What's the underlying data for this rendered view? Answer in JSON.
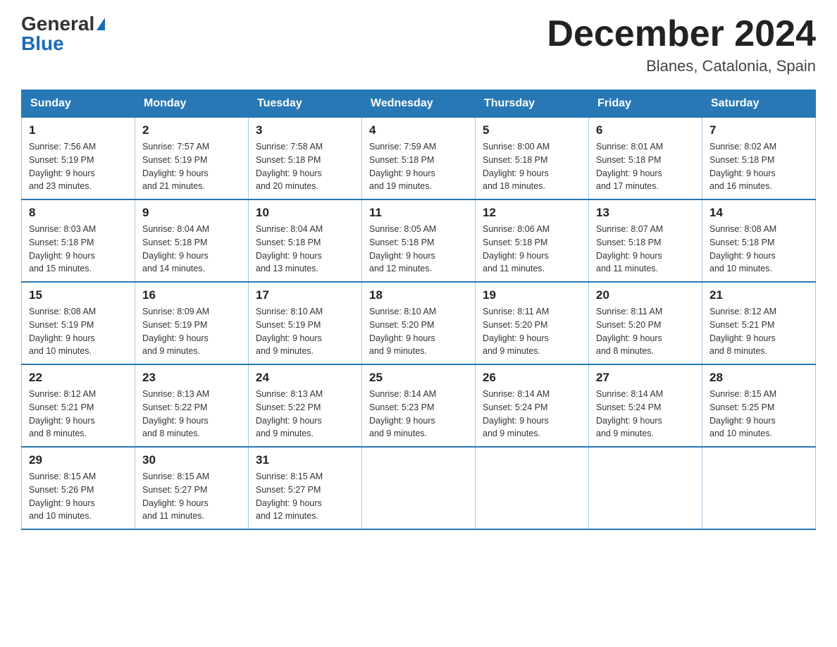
{
  "header": {
    "logo_general": "General",
    "logo_blue": "Blue",
    "month_title": "December 2024",
    "location": "Blanes, Catalonia, Spain"
  },
  "days_of_week": [
    "Sunday",
    "Monday",
    "Tuesday",
    "Wednesday",
    "Thursday",
    "Friday",
    "Saturday"
  ],
  "weeks": [
    [
      {
        "day": "1",
        "sunrise": "7:56 AM",
        "sunset": "5:19 PM",
        "daylight": "9 hours and 23 minutes."
      },
      {
        "day": "2",
        "sunrise": "7:57 AM",
        "sunset": "5:19 PM",
        "daylight": "9 hours and 21 minutes."
      },
      {
        "day": "3",
        "sunrise": "7:58 AM",
        "sunset": "5:18 PM",
        "daylight": "9 hours and 20 minutes."
      },
      {
        "day": "4",
        "sunrise": "7:59 AM",
        "sunset": "5:18 PM",
        "daylight": "9 hours and 19 minutes."
      },
      {
        "day": "5",
        "sunrise": "8:00 AM",
        "sunset": "5:18 PM",
        "daylight": "9 hours and 18 minutes."
      },
      {
        "day": "6",
        "sunrise": "8:01 AM",
        "sunset": "5:18 PM",
        "daylight": "9 hours and 17 minutes."
      },
      {
        "day": "7",
        "sunrise": "8:02 AM",
        "sunset": "5:18 PM",
        "daylight": "9 hours and 16 minutes."
      }
    ],
    [
      {
        "day": "8",
        "sunrise": "8:03 AM",
        "sunset": "5:18 PM",
        "daylight": "9 hours and 15 minutes."
      },
      {
        "day": "9",
        "sunrise": "8:04 AM",
        "sunset": "5:18 PM",
        "daylight": "9 hours and 14 minutes."
      },
      {
        "day": "10",
        "sunrise": "8:04 AM",
        "sunset": "5:18 PM",
        "daylight": "9 hours and 13 minutes."
      },
      {
        "day": "11",
        "sunrise": "8:05 AM",
        "sunset": "5:18 PM",
        "daylight": "9 hours and 12 minutes."
      },
      {
        "day": "12",
        "sunrise": "8:06 AM",
        "sunset": "5:18 PM",
        "daylight": "9 hours and 11 minutes."
      },
      {
        "day": "13",
        "sunrise": "8:07 AM",
        "sunset": "5:18 PM",
        "daylight": "9 hours and 11 minutes."
      },
      {
        "day": "14",
        "sunrise": "8:08 AM",
        "sunset": "5:18 PM",
        "daylight": "9 hours and 10 minutes."
      }
    ],
    [
      {
        "day": "15",
        "sunrise": "8:08 AM",
        "sunset": "5:19 PM",
        "daylight": "9 hours and 10 minutes."
      },
      {
        "day": "16",
        "sunrise": "8:09 AM",
        "sunset": "5:19 PM",
        "daylight": "9 hours and 9 minutes."
      },
      {
        "day": "17",
        "sunrise": "8:10 AM",
        "sunset": "5:19 PM",
        "daylight": "9 hours and 9 minutes."
      },
      {
        "day": "18",
        "sunrise": "8:10 AM",
        "sunset": "5:20 PM",
        "daylight": "9 hours and 9 minutes."
      },
      {
        "day": "19",
        "sunrise": "8:11 AM",
        "sunset": "5:20 PM",
        "daylight": "9 hours and 9 minutes."
      },
      {
        "day": "20",
        "sunrise": "8:11 AM",
        "sunset": "5:20 PM",
        "daylight": "9 hours and 8 minutes."
      },
      {
        "day": "21",
        "sunrise": "8:12 AM",
        "sunset": "5:21 PM",
        "daylight": "9 hours and 8 minutes."
      }
    ],
    [
      {
        "day": "22",
        "sunrise": "8:12 AM",
        "sunset": "5:21 PM",
        "daylight": "9 hours and 8 minutes."
      },
      {
        "day": "23",
        "sunrise": "8:13 AM",
        "sunset": "5:22 PM",
        "daylight": "9 hours and 8 minutes."
      },
      {
        "day": "24",
        "sunrise": "8:13 AM",
        "sunset": "5:22 PM",
        "daylight": "9 hours and 9 minutes."
      },
      {
        "day": "25",
        "sunrise": "8:14 AM",
        "sunset": "5:23 PM",
        "daylight": "9 hours and 9 minutes."
      },
      {
        "day": "26",
        "sunrise": "8:14 AM",
        "sunset": "5:24 PM",
        "daylight": "9 hours and 9 minutes."
      },
      {
        "day": "27",
        "sunrise": "8:14 AM",
        "sunset": "5:24 PM",
        "daylight": "9 hours and 9 minutes."
      },
      {
        "day": "28",
        "sunrise": "8:15 AM",
        "sunset": "5:25 PM",
        "daylight": "9 hours and 10 minutes."
      }
    ],
    [
      {
        "day": "29",
        "sunrise": "8:15 AM",
        "sunset": "5:26 PM",
        "daylight": "9 hours and 10 minutes."
      },
      {
        "day": "30",
        "sunrise": "8:15 AM",
        "sunset": "5:27 PM",
        "daylight": "9 hours and 11 minutes."
      },
      {
        "day": "31",
        "sunrise": "8:15 AM",
        "sunset": "5:27 PM",
        "daylight": "9 hours and 12 minutes."
      },
      null,
      null,
      null,
      null
    ]
  ]
}
